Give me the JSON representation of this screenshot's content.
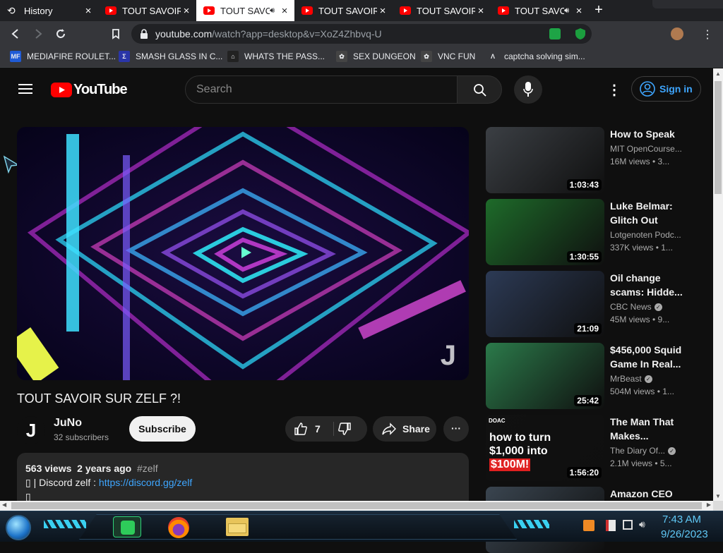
{
  "browser": {
    "tabs": [
      {
        "label": "History",
        "icon": "history-icon",
        "audio": false,
        "active": false
      },
      {
        "label": "TOUT SAVOIR S",
        "icon": "youtube-favicon",
        "audio": false,
        "active": false
      },
      {
        "label": "TOUT SAVC",
        "icon": "youtube-favicon",
        "audio": true,
        "active": true
      },
      {
        "label": "TOUT SAVOIR S",
        "icon": "youtube-favicon",
        "audio": false,
        "active": false
      },
      {
        "label": "TOUT SAVOIR S",
        "icon": "youtube-favicon",
        "audio": false,
        "active": false
      },
      {
        "label": "TOUT SAVC",
        "icon": "youtube-favicon",
        "audio": true,
        "active": false
      }
    ],
    "tab_close": "×",
    "new_tab": "+",
    "url_host": "youtube.com",
    "url_path": "/watch?app=desktop&v=XoZ4Zhbvq-U",
    "bookmarks": [
      {
        "label": "MEDIAFIRE ROULET...",
        "icon_text": "MF",
        "icon_color": "#1f5bd6"
      },
      {
        "label": "SMASH GLASS IN C...",
        "icon_text": "Σ",
        "icon_color": "#2a35a8"
      },
      {
        "label": "WHATS THE PASS...",
        "icon_text": "⌂",
        "icon_color": "#222222"
      },
      {
        "label": "SEX DUNGEON",
        "icon_text": "✿",
        "icon_color": "#444444"
      },
      {
        "label": "VNC FUN",
        "icon_text": "✿",
        "icon_color": "#444444"
      },
      {
        "label": "captcha solving sim...",
        "icon_text": "Λ",
        "icon_color": "#35363a"
      }
    ]
  },
  "youtube": {
    "logo_text": "YouTube",
    "search_placeholder": "Search",
    "signin_label": "Sign in",
    "video": {
      "title": "TOUT SAVOIR SUR ZELF ?!",
      "channel": "JuNo",
      "channel_initial": "J",
      "subscribers": "32 subscribers",
      "subscribe_label": "Subscribe",
      "likes": "7",
      "share_label": "Share",
      "more_label": "···",
      "views": "563 views",
      "age": "2 years ago",
      "hashtag": "#zelf",
      "desc_prefix": "▯ | Discord zelf : ",
      "desc_link": "https://discord.gg/zelf",
      "desc_line2": "▯",
      "watermark": "J"
    },
    "recommendations": [
      {
        "title": "How to Speak",
        "channel": "MIT OpenCourse...",
        "verified": false,
        "meta": "16M views  •  3...",
        "duration": "1:03:43",
        "thumb_color": "#3b3f44"
      },
      {
        "title": "Luke Belmar: Glitch Out The...",
        "channel": "Lotgenoten Podc...",
        "verified": false,
        "meta": "337K views  •  1...",
        "duration": "1:30:55",
        "thumb_color": "#1e6b2a"
      },
      {
        "title": "Oil change scams: Hidde...",
        "channel": "CBC News",
        "verified": true,
        "meta": "45M views  •  9...",
        "duration": "21:09",
        "thumb_color": "#2c3a55"
      },
      {
        "title": "$456,000 Squid Game In Real...",
        "channel": "MrBeast",
        "verified": true,
        "meta": "504M views  •  1...",
        "duration": "25:42",
        "thumb_color": "#2b7a4a"
      },
      {
        "title": "The Man That Makes...",
        "channel": "The Diary Of...",
        "verified": true,
        "meta": "2.1M views  •  5...",
        "duration": "1:56:20",
        "thumb_color": "#111111",
        "thumb_text": [
          "how to turn",
          "$1,000 into",
          "$100M!"
        ],
        "thumb_badge": "DOAC"
      },
      {
        "title": "Amazon CEO",
        "channel": "",
        "verified": false,
        "meta": "",
        "duration": "",
        "thumb_color": "#3a4550"
      }
    ]
  },
  "taskbar": {
    "time": "7:43 AM",
    "date": "9/26/2023"
  },
  "colors": {
    "yt_red": "#ff0000",
    "link_blue": "#3ea6ff",
    "clock_cyan": "#60c8f5"
  }
}
